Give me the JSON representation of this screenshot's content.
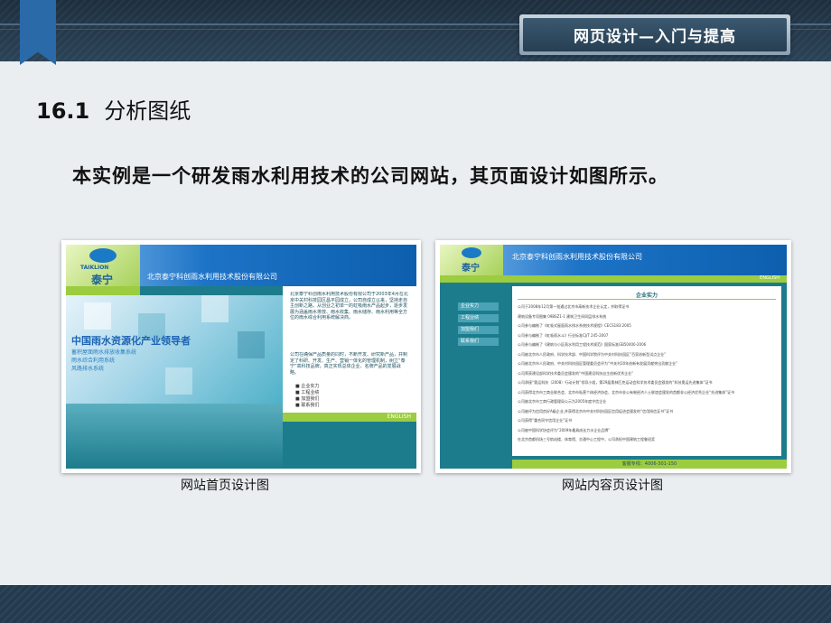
{
  "header": {
    "banner_title": "网页设计—入门与提高"
  },
  "section": {
    "number": "16.1",
    "title": "分析图纸"
  },
  "intro_text": "本实例是一个研发雨水利用技术的公司网站，其页面设计如图所示。",
  "figure1": {
    "caption": "网站首页设计图",
    "logo_en": "TAIKLION",
    "logo_cn": "泰宁",
    "company_cn": "北京泰宁科创雨水利用技术股份有限公司",
    "slogan": "中国雨水资源化产业领导者",
    "products": [
      "蓄积屋面雨水排放收集系统",
      "雨水综合利用系统",
      "风路排水系统"
    ],
    "intro_paragraph_1": "北京泰宁科创雨水利用技术股份有限公司于2003年4月在北京中关村科技园区昌平园成立，公司自成立以来，坚持走自主创新之路，从创业之初单一的虹吸雨水产品起步，逐步发展为涵盖雨水排放、雨水收集、雨水储存、雨水利用等全方位的雨水综合利用系统解决商。",
    "intro_paragraph_2": "公司在确保产品质量的同时，不断开发、研究新产品，并制定了科研、开发、生产、营销一体化的管理机制，树立“泰宁”高科技品牌，真正实现总体企业、名牌产品的发展战略。",
    "menu": [
      "企业实力",
      "工程业绩",
      "加盟我们",
      "联系我们"
    ],
    "english": "ENGLISH"
  },
  "figure2": {
    "caption": "网站内容页设计图",
    "logo_cn": "泰宁",
    "company_cn": "北京泰宁科创雨水利用技术股份有限公司",
    "english": "ENGLISH",
    "sidebar": [
      "企业实力",
      "工程业绩",
      "加盟我们",
      "联系我们"
    ],
    "content_title": "企业实力",
    "lines": [
      "公司于2008年12月第一批通过北京市高新技术企业认定，并取得证书",
      "建筑设备专项图集 09BSZ1-1 建筑卫生间同层排水系统",
      "公司参与编制了《虹吸式屋面雨水排水系统技术规程》CECS183:2005",
      "公司参与编制了《虹吸雨水斗》行业标准CJ/T 245-2007",
      "公司参与编制了《建筑与小区雨水利用工程技术规范》国家标准GB50400-2006",
      "公司被北京市人民政府、科学技术部、中国科学院评为中关村科技园区“百家创新型试点企业”",
      "公司被北京市人民政府、中关村科技园区管理委员会评为“中关村20年创新有发展贡献突出贡献企业”",
      "公司荣获建设部科学技术委员会颁发的“中国建设科技自主创新优秀企业”",
      "公司承接“奥运科技（2008）行动计划”领导小组，第29届奥林匹克运动会科学技术委员会颁发的“科技奥运先进集体”证书",
      "公司获得北京市工商业联合会、北京市私营个体经济协会、北京市非公有制经济人士联谊会颁发的首都非公经济优秀企业“先进集体”证书",
      "公司被北京市工商行政管理局公示为2005年度守信企业",
      "公司被评为信用良好A级企业,并获得北京市中关村科技园区信用促进会颁发的“信用授信证书”证书",
      "公司获得“重合同守信用企业”证书",
      "公司被中国科学协会评为“2009年最具成长力水企业品牌”",
      "在北京首都机场三号航站楼、体育馆、交通中心工程中，公司承担中国建筑工程鲁班奖"
    ],
    "hotline": "客服专线：4006-301-150"
  }
}
